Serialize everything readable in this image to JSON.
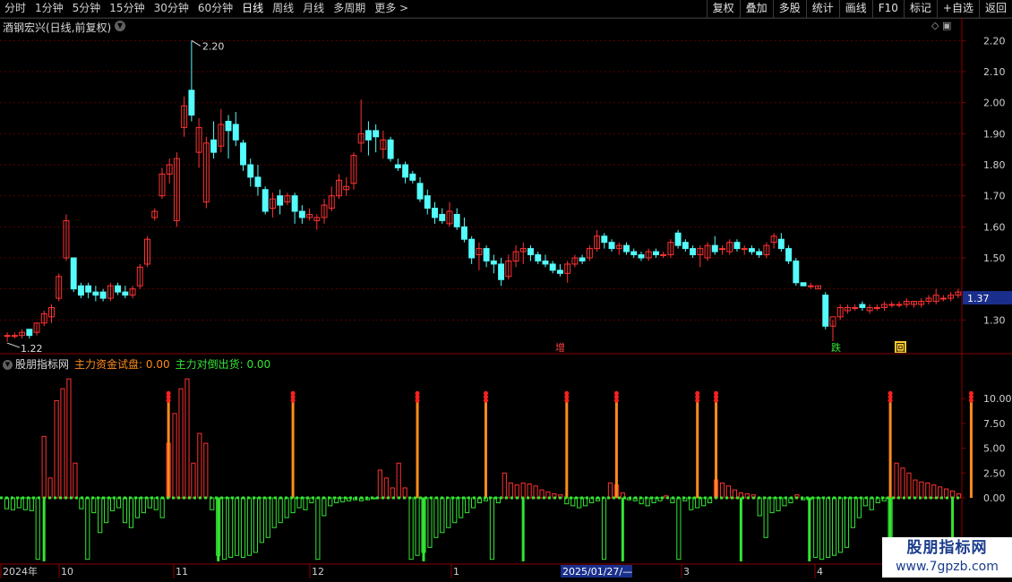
{
  "toolbar": {
    "tabs": [
      "分时",
      "1分钟",
      "5分钟",
      "15分钟",
      "30分钟",
      "60分钟",
      "日线",
      "周线",
      "月线",
      "多周期",
      "更多 >"
    ],
    "active_tab": "日线",
    "tools": [
      "复权",
      "叠加",
      "多股",
      "统计",
      "画线",
      "F10",
      "标记",
      "+自选",
      "返回"
    ]
  },
  "stock": {
    "title": "酒钢宏兴(日线,前复权)",
    "last_price": "1.37",
    "high_label": "2.20",
    "low_label": "1.22"
  },
  "price_axis": {
    "ticks": [
      "2.20",
      "2.10",
      "2.00",
      "1.90",
      "1.80",
      "1.70",
      "1.60",
      "1.50",
      "1.30"
    ]
  },
  "markers": {
    "zeng": "增",
    "die": "跌",
    "hui": "回"
  },
  "indicator": {
    "name": "股朋指标网",
    "series1_label": "主力资金试盘: 0.00",
    "series2_label": "主力对倒出货: 0.00",
    "axis_ticks": [
      "10.00",
      "7.50",
      "5.00",
      "2.50",
      "0.00"
    ]
  },
  "time_axis": {
    "labels": [
      "2024年",
      "10",
      "11",
      "12",
      "1",
      "3",
      "4"
    ],
    "cursor_label": "2025/01/27/—"
  },
  "watermark": {
    "line1": "股朋指标网",
    "line2": "www.7gpzb.com"
  },
  "colors": {
    "up": "#ff3232",
    "down": "#54fcfc",
    "orange": "#ff8c1a",
    "green": "#33e633"
  },
  "chart_data": {
    "type": "candlestick",
    "ylim": [
      1.2,
      2.25
    ],
    "note_extremes": {
      "high": 2.2,
      "low": 1.22
    },
    "candles": [
      [
        1.25,
        1.26,
        1.23,
        1.25
      ],
      [
        1.25,
        1.26,
        1.24,
        1.25
      ],
      [
        1.25,
        1.27,
        1.24,
        1.26
      ],
      [
        1.27,
        1.27,
        1.24,
        1.25
      ],
      [
        1.26,
        1.29,
        1.25,
        1.29
      ],
      [
        1.29,
        1.33,
        1.28,
        1.32
      ],
      [
        1.31,
        1.35,
        1.29,
        1.34
      ],
      [
        1.37,
        1.45,
        1.36,
        1.44
      ],
      [
        1.5,
        1.64,
        1.49,
        1.62
      ],
      [
        1.5,
        1.5,
        1.39,
        1.4
      ],
      [
        1.41,
        1.42,
        1.37,
        1.38
      ],
      [
        1.41,
        1.42,
        1.37,
        1.39
      ],
      [
        1.39,
        1.41,
        1.36,
        1.38
      ],
      [
        1.39,
        1.4,
        1.36,
        1.37
      ],
      [
        1.37,
        1.42,
        1.36,
        1.41
      ],
      [
        1.41,
        1.42,
        1.38,
        1.39
      ],
      [
        1.39,
        1.41,
        1.37,
        1.38
      ],
      [
        1.38,
        1.41,
        1.37,
        1.4
      ],
      [
        1.41,
        1.48,
        1.4,
        1.47
      ],
      [
        1.48,
        1.57,
        1.47,
        1.56
      ],
      [
        1.63,
        1.66,
        1.62,
        1.65
      ],
      [
        1.7,
        1.79,
        1.69,
        1.77
      ],
      [
        1.77,
        1.82,
        1.74,
        1.8
      ],
      [
        1.62,
        1.84,
        1.6,
        1.82
      ],
      [
        1.92,
        2.02,
        1.89,
        1.99
      ],
      [
        2.04,
        2.2,
        1.94,
        1.96
      ],
      [
        1.84,
        1.95,
        1.79,
        1.92
      ],
      [
        1.68,
        1.89,
        1.66,
        1.87
      ],
      [
        1.88,
        1.94,
        1.82,
        1.84
      ],
      [
        1.86,
        1.98,
        1.84,
        1.93
      ],
      [
        1.94,
        1.96,
        1.82,
        1.91
      ],
      [
        1.93,
        1.97,
        1.86,
        1.88
      ],
      [
        1.87,
        1.88,
        1.78,
        1.8
      ],
      [
        1.8,
        1.82,
        1.73,
        1.76
      ],
      [
        1.76,
        1.8,
        1.7,
        1.73
      ],
      [
        1.72,
        1.73,
        1.64,
        1.65
      ],
      [
        1.66,
        1.71,
        1.63,
        1.69
      ],
      [
        1.7,
        1.72,
        1.64,
        1.67
      ],
      [
        1.68,
        1.71,
        1.67,
        1.7
      ],
      [
        1.7,
        1.71,
        1.61,
        1.65
      ],
      [
        1.65,
        1.67,
        1.61,
        1.63
      ],
      [
        1.63,
        1.66,
        1.62,
        1.64
      ],
      [
        1.62,
        1.64,
        1.59,
        1.63
      ],
      [
        1.63,
        1.69,
        1.61,
        1.67
      ],
      [
        1.66,
        1.73,
        1.65,
        1.7
      ],
      [
        1.7,
        1.77,
        1.69,
        1.75
      ],
      [
        1.72,
        1.76,
        1.7,
        1.73
      ],
      [
        1.74,
        1.84,
        1.72,
        1.83
      ],
      [
        1.87,
        2.01,
        1.84,
        1.9
      ],
      [
        1.91,
        1.94,
        1.83,
        1.88
      ],
      [
        1.91,
        1.93,
        1.84,
        1.89
      ],
      [
        1.85,
        1.91,
        1.82,
        1.88
      ],
      [
        1.88,
        1.89,
        1.81,
        1.82
      ],
      [
        1.8,
        1.82,
        1.78,
        1.79
      ],
      [
        1.8,
        1.81,
        1.74,
        1.76
      ],
      [
        1.77,
        1.78,
        1.74,
        1.75
      ],
      [
        1.74,
        1.76,
        1.68,
        1.69
      ],
      [
        1.7,
        1.72,
        1.64,
        1.66
      ],
      [
        1.66,
        1.68,
        1.61,
        1.63
      ],
      [
        1.64,
        1.66,
        1.61,
        1.62
      ],
      [
        1.61,
        1.68,
        1.6,
        1.65
      ],
      [
        1.64,
        1.66,
        1.59,
        1.6
      ],
      [
        1.6,
        1.63,
        1.55,
        1.56
      ],
      [
        1.56,
        1.57,
        1.48,
        1.5
      ],
      [
        1.51,
        1.55,
        1.46,
        1.53
      ],
      [
        1.53,
        1.54,
        1.47,
        1.49
      ],
      [
        1.49,
        1.51,
        1.45,
        1.48
      ],
      [
        1.48,
        1.5,
        1.41,
        1.43
      ],
      [
        1.44,
        1.51,
        1.43,
        1.49
      ],
      [
        1.49,
        1.54,
        1.47,
        1.52
      ],
      [
        1.52,
        1.55,
        1.48,
        1.53
      ],
      [
        1.53,
        1.54,
        1.49,
        1.51
      ],
      [
        1.51,
        1.52,
        1.48,
        1.49
      ],
      [
        1.49,
        1.51,
        1.47,
        1.48
      ],
      [
        1.48,
        1.49,
        1.45,
        1.46
      ],
      [
        1.46,
        1.48,
        1.44,
        1.45
      ],
      [
        1.45,
        1.49,
        1.42,
        1.48
      ],
      [
        1.48,
        1.51,
        1.47,
        1.5
      ],
      [
        1.5,
        1.51,
        1.48,
        1.49
      ],
      [
        1.5,
        1.54,
        1.49,
        1.53
      ],
      [
        1.53,
        1.59,
        1.52,
        1.57
      ],
      [
        1.57,
        1.58,
        1.53,
        1.55
      ],
      [
        1.55,
        1.56,
        1.52,
        1.53
      ],
      [
        1.53,
        1.55,
        1.51,
        1.54
      ],
      [
        1.54,
        1.55,
        1.51,
        1.52
      ],
      [
        1.52,
        1.53,
        1.5,
        1.51
      ],
      [
        1.51,
        1.52,
        1.49,
        1.5
      ],
      [
        1.5,
        1.53,
        1.49,
        1.52
      ],
      [
        1.52,
        1.53,
        1.5,
        1.51
      ],
      [
        1.51,
        1.52,
        1.5,
        1.51
      ],
      [
        1.51,
        1.56,
        1.5,
        1.55
      ],
      [
        1.58,
        1.59,
        1.53,
        1.54
      ],
      [
        1.55,
        1.56,
        1.52,
        1.53
      ],
      [
        1.53,
        1.54,
        1.5,
        1.51
      ],
      [
        1.51,
        1.54,
        1.47,
        1.53
      ],
      [
        1.5,
        1.55,
        1.49,
        1.54
      ],
      [
        1.54,
        1.57,
        1.51,
        1.52
      ],
      [
        1.53,
        1.54,
        1.51,
        1.53
      ],
      [
        1.52,
        1.56,
        1.51,
        1.55
      ],
      [
        1.55,
        1.56,
        1.52,
        1.53
      ],
      [
        1.53,
        1.54,
        1.51,
        1.53
      ],
      [
        1.53,
        1.54,
        1.51,
        1.52
      ],
      [
        1.52,
        1.53,
        1.5,
        1.51
      ],
      [
        1.51,
        1.55,
        1.5,
        1.54
      ],
      [
        1.55,
        1.58,
        1.53,
        1.57
      ],
      [
        1.56,
        1.58,
        1.52,
        1.53
      ],
      [
        1.53,
        1.54,
        1.48,
        1.49
      ],
      [
        1.49,
        1.5,
        1.41,
        1.42
      ],
      [
        1.42,
        1.42,
        1.41,
        1.41
      ],
      [
        1.41,
        1.42,
        1.4,
        1.41
      ],
      [
        1.4,
        1.41,
        1.4,
        1.41
      ],
      [
        1.38,
        1.39,
        1.27,
        1.28
      ],
      [
        1.28,
        1.3,
        1.23,
        1.31
      ],
      [
        1.31,
        1.35,
        1.3,
        1.34
      ],
      [
        1.33,
        1.35,
        1.32,
        1.34
      ],
      [
        1.34,
        1.35,
        1.33,
        1.34
      ],
      [
        1.35,
        1.36,
        1.33,
        1.34
      ],
      [
        1.33,
        1.35,
        1.32,
        1.34
      ],
      [
        1.34,
        1.35,
        1.33,
        1.34
      ],
      [
        1.34,
        1.36,
        1.33,
        1.35
      ],
      [
        1.35,
        1.36,
        1.34,
        1.35
      ],
      [
        1.35,
        1.36,
        1.34,
        1.35
      ],
      [
        1.35,
        1.37,
        1.34,
        1.36
      ],
      [
        1.35,
        1.36,
        1.34,
        1.36
      ],
      [
        1.35,
        1.37,
        1.34,
        1.36
      ],
      [
        1.36,
        1.38,
        1.35,
        1.37
      ],
      [
        1.36,
        1.4,
        1.35,
        1.38
      ],
      [
        1.37,
        1.38,
        1.36,
        1.37
      ],
      [
        1.37,
        1.39,
        1.36,
        1.38
      ],
      [
        1.38,
        1.4,
        1.37,
        1.39
      ]
    ],
    "indicator_ylim": [
      -6.5,
      13
    ],
    "indicator_bars": [
      -1.1,
      -1.2,
      -1.0,
      -1.2,
      -1.3,
      -6.2,
      6.2,
      2.0,
      9.8,
      11.0,
      12.0,
      3.5,
      -1.1,
      -6.2,
      -1.5,
      -3.5,
      -2.5,
      -1.3,
      -1.0,
      -2.5,
      -3.0,
      -2.0,
      -1.5,
      -1.0,
      -1.2,
      -2.0,
      5.5,
      8.5,
      11.0,
      12.0,
      3.5,
      6.5,
      5.5,
      -1.2,
      -5.8,
      -6.2,
      -6.0,
      -5.8,
      -6.0,
      -5.8,
      -5.5,
      -4.5,
      -4.0,
      -3.0,
      -2.5,
      -2.0,
      -1.5,
      -1.0,
      -1.2,
      -0.5,
      -6.2,
      -1.8,
      -0.8,
      -0.5,
      -0.4,
      -0.3,
      -0.2,
      -0.3,
      -0.2,
      -0.1,
      2.8,
      2.0,
      1.0,
      3.5,
      1.0,
      -6.2,
      -5.8,
      -5.5,
      -5.0,
      -4.0,
      -3.5,
      -3.0,
      -2.5,
      -2.0,
      -1.5,
      -1.0,
      -0.5,
      -0.3,
      -6.2,
      -0.5,
      2.5,
      1.5,
      1.3,
      1.5,
      1.4,
      1.2,
      0.8,
      0.6,
      0.4,
      0.3,
      -0.6,
      -0.8,
      -1.0,
      -0.8,
      -0.5,
      -0.3,
      -6.2,
      1.5,
      1.3,
      0.5,
      -0.2,
      -0.3,
      -0.6,
      -0.8,
      -0.5,
      -0.3,
      0.2,
      -0.5,
      -6.2,
      -0.3,
      -1.2,
      -1.0,
      -0.8,
      -0.5,
      1.8,
      1.5,
      1.2,
      0.8,
      0.5,
      0.4,
      0.3,
      -1.8,
      -4.0,
      -1.5,
      -1.3,
      -0.8,
      -0.5,
      0.3,
      -0.2,
      -0.2,
      -6.0,
      -6.2,
      -6.0,
      -5.8,
      -5.5,
      -5.0,
      -3.0,
      -2.0,
      -0.8,
      -1.2,
      -0.5,
      -0.3,
      -6.2,
      3.5,
      3.0,
      2.5,
      1.8,
      1.6,
      1.5,
      1.3,
      1.1,
      0.9,
      0.7,
      0.4
    ],
    "green_spikes": [
      6,
      34,
      67,
      83,
      99,
      118,
      129,
      142,
      152,
      171,
      190
    ],
    "orange_spikes": [
      26,
      46,
      66,
      77,
      90,
      98,
      111,
      114,
      142,
      155,
      169
    ]
  }
}
